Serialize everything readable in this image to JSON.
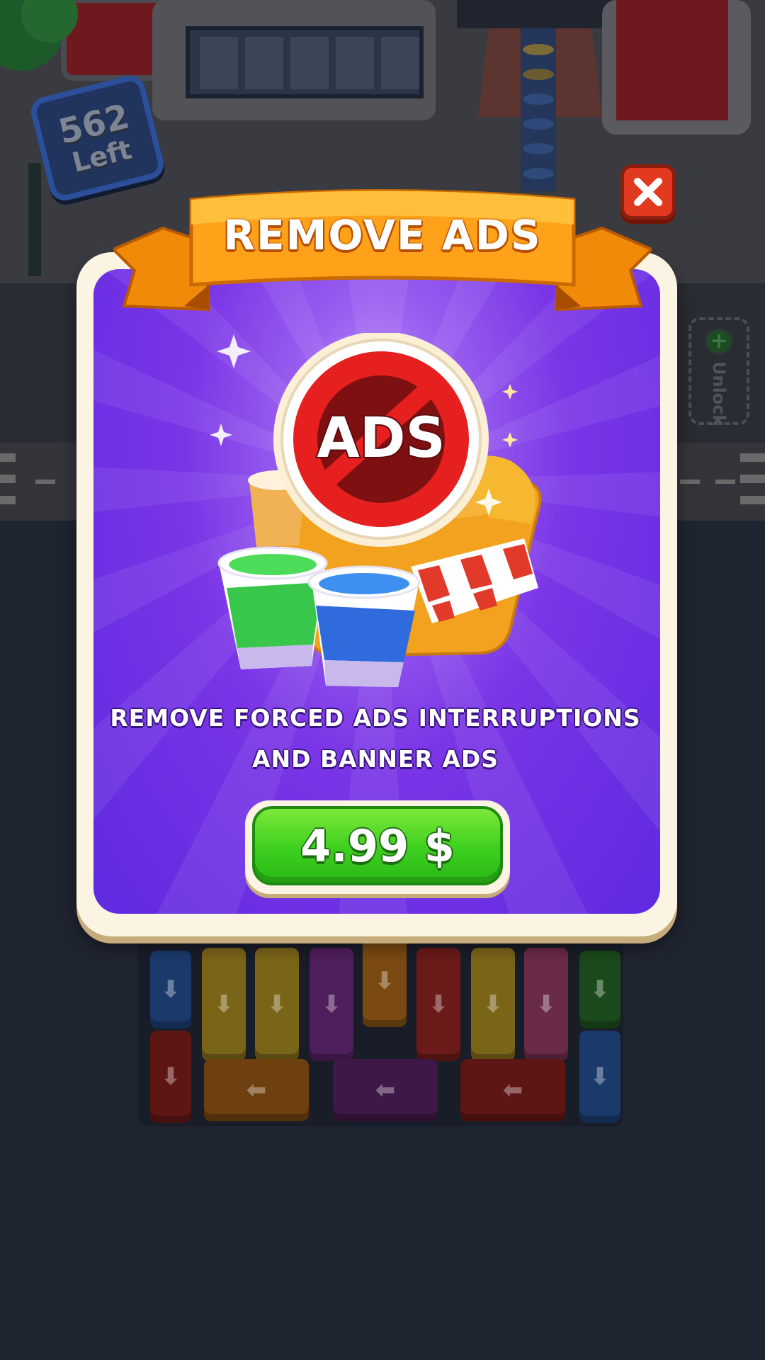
{
  "game": {
    "counter": {
      "value": "562",
      "label": "Left"
    },
    "unlock_slot": {
      "label": "Unlock"
    }
  },
  "dialog": {
    "title": "REMOVE ADS",
    "badge_text": "ADS",
    "description_line1": "REMOVE FORCED ADS INTERRUPTIONS",
    "description_line2": "AND BANNER ADS",
    "price_label": "4.99 $"
  },
  "icons": {
    "close": "close-icon",
    "no_ads": "no-ads-icon",
    "arrow_down": "arrow-down-icon",
    "arrow_left": "arrow-left-icon",
    "plus": "plus-icon"
  },
  "colors": {
    "ribbon": "#ffa21a",
    "panel": "#7a35e6",
    "price_button": "#3ccf1e",
    "close_button": "#e23a1e"
  }
}
